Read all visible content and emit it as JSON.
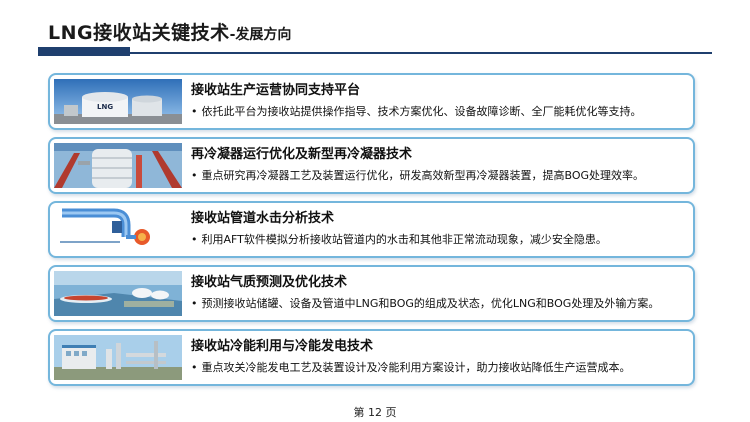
{
  "header": {
    "title": "LNG接收站关键技术",
    "subtitle": "-发展方向"
  },
  "cards": [
    {
      "heading": "接收站生产运营协同支持平台",
      "description": "依托此平台为接收站提供操作指导、技术方案优化、设备故障诊断、全厂能耗优化等支持。",
      "image_icon": "lng-tank-photo-icon",
      "image_text": "LNG"
    },
    {
      "heading": "再冷凝器运行优化及新型再冷凝器技术",
      "description": "重点研究再冷凝器工艺及装置运行优化，研发高效新型再冷凝器装置，提高BOG处理效率。",
      "image_icon": "recondenser-photo-icon"
    },
    {
      "heading": "接收站管道水击分析技术",
      "description": "利用AFT软件模拟分析接收站管道内的水击和其他非正常流动现象，减少安全隐患。",
      "image_icon": "pipeline-diagram-icon"
    },
    {
      "heading": "接收站气质预测及优化技术",
      "description": "预测接收站储罐、设备及管道中LNG和BOG的组成及状态，优化LNG和BOG处理及外输方案。",
      "image_icon": "terminal-aerial-photo-icon"
    },
    {
      "heading": "接收站冷能利用与冷能发电技术",
      "description": "重点攻关冷能发电工艺及装置设计及冷能利用方案设计，助力接收站降低生产运营成本。",
      "image_icon": "cold-energy-plant-photo-icon"
    }
  ],
  "bullet": "•",
  "footer": {
    "page_label": "第 12 页"
  },
  "colors": {
    "accent": "#1f3f6e",
    "card_border": "#74b6dc"
  }
}
